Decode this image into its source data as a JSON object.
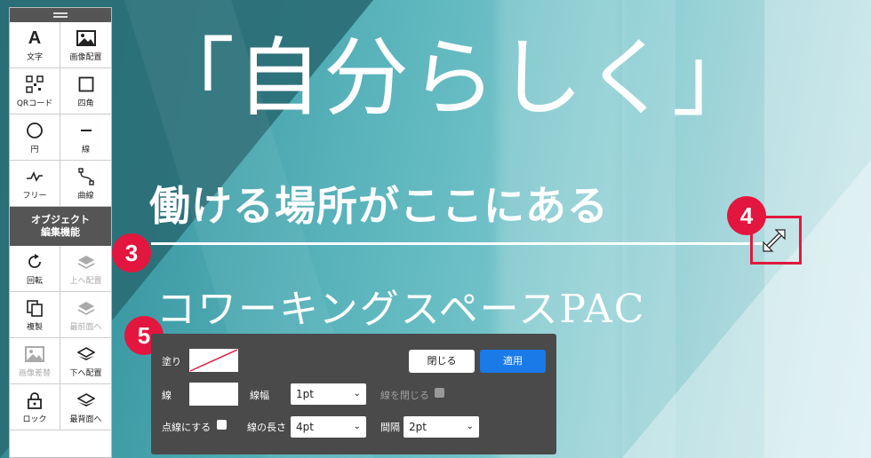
{
  "canvas": {
    "headline": "「自分らしく」",
    "subheadline": "働ける場所がここにある",
    "brand": "コワーキングスペースPAC"
  },
  "badges": {
    "b3": "3",
    "b4": "4",
    "b5": "5"
  },
  "toolbar": {
    "tools": [
      {
        "icon": "text-icon",
        "label": "文字"
      },
      {
        "icon": "image-icon",
        "label": "画像配置"
      },
      {
        "icon": "qr-code-icon",
        "label": "QRコード"
      },
      {
        "icon": "square-icon",
        "label": "四角"
      },
      {
        "icon": "circle-icon",
        "label": "円"
      },
      {
        "icon": "line-icon",
        "label": "線"
      },
      {
        "icon": "freehand-icon",
        "label": "フリー"
      },
      {
        "icon": "curve-icon",
        "label": "曲線"
      }
    ],
    "section_title": "オブジェクト\n編集機能",
    "edit_tools": [
      {
        "icon": "rotate-icon",
        "label": "回転",
        "enabled": true
      },
      {
        "icon": "layers-up-icon",
        "label": "上へ配置",
        "enabled": false
      },
      {
        "icon": "duplicate-icon",
        "label": "複製",
        "enabled": true
      },
      {
        "icon": "layers-front-icon",
        "label": "最前面へ",
        "enabled": false
      },
      {
        "icon": "image-replace-icon",
        "label": "画像差替",
        "enabled": false
      },
      {
        "icon": "layers-down-icon",
        "label": "下へ配置",
        "enabled": true
      },
      {
        "icon": "lock-icon",
        "label": "ロック",
        "enabled": true
      },
      {
        "icon": "layers-back-icon",
        "label": "最背面へ",
        "enabled": true
      }
    ]
  },
  "panel": {
    "fill_label": "塗り",
    "stroke_label": "線",
    "stroke_width_label": "線幅",
    "stroke_width_value": "1pt",
    "close_path_label": "線を閉じる",
    "dashed_label": "点線にする",
    "dash_length_label": "線の長さ",
    "dash_length_value": "4pt",
    "gap_label": "間隔",
    "gap_value": "2pt",
    "close_button": "閉じる",
    "apply_button": "適用"
  },
  "colors": {
    "accent": "#e3163f",
    "apply": "#1a7ae8",
    "panel": "#4a4a4a"
  }
}
